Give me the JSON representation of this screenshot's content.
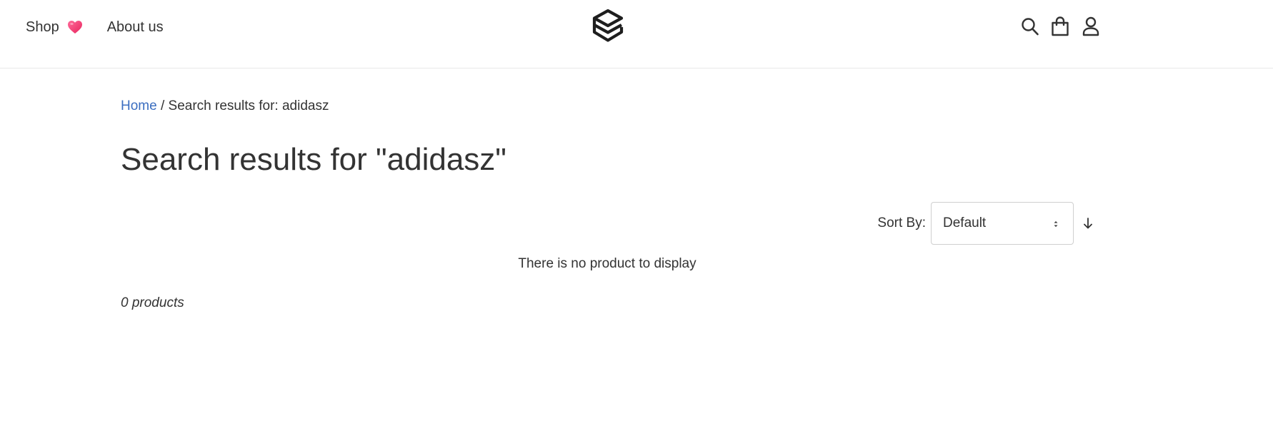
{
  "nav": {
    "shop_label": "Shop",
    "about_label": "About us"
  },
  "icons": {
    "heart": "heart-icon",
    "logo": "stacked-layers-logo",
    "search": "search-icon",
    "cart": "shopping-bag-icon",
    "account": "user-icon",
    "sort_direction": "arrow-down-icon",
    "select_caret": "updown-caret-icon"
  },
  "colors": {
    "link": "#3b6ec0",
    "heart": "#f0427a",
    "text": "#333333"
  },
  "breadcrumb": {
    "home_label": "Home",
    "separator": " / ",
    "current": "Search results for: adidasz"
  },
  "page": {
    "title": "Search results for \"adidasz\""
  },
  "sort": {
    "label": "Sort By:",
    "selected": "Default"
  },
  "results": {
    "empty_message": "There is no product to display",
    "count_text": "0 products"
  }
}
